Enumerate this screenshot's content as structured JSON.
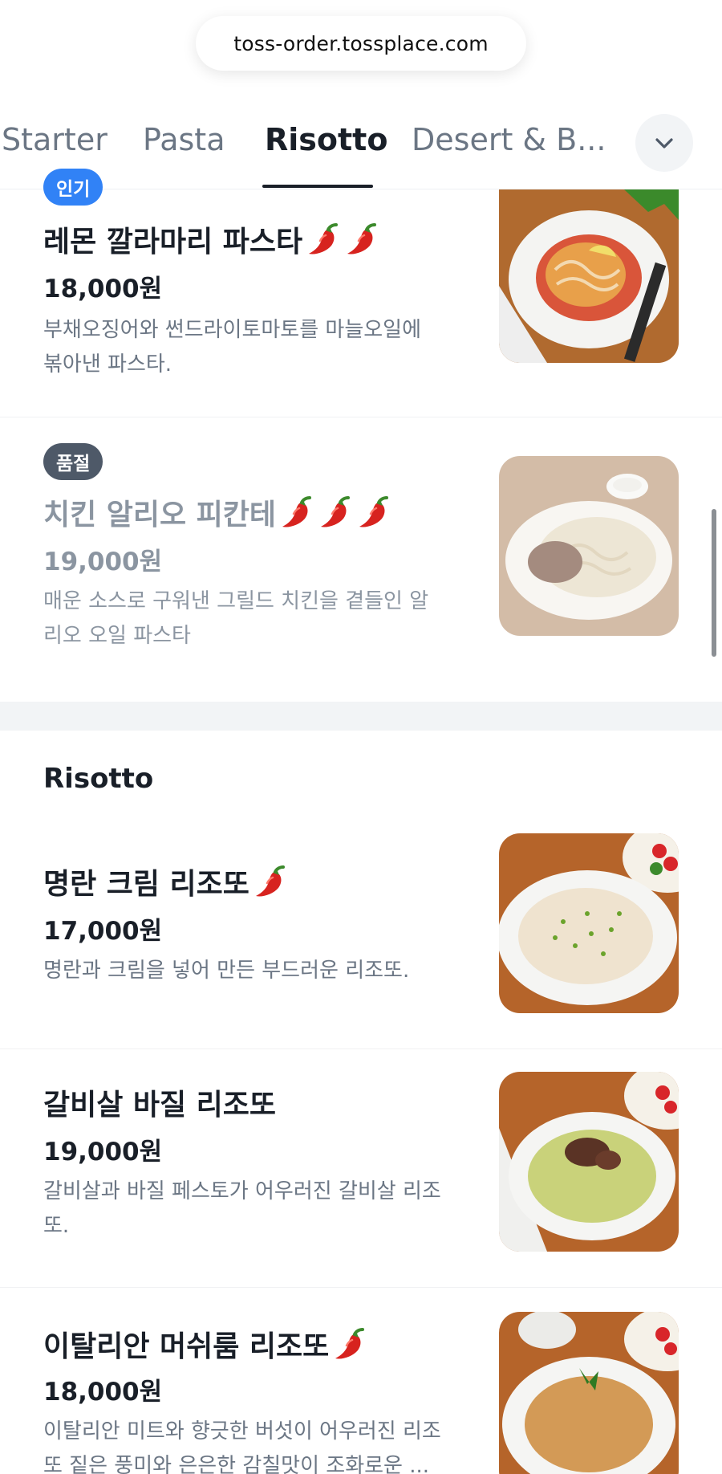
{
  "browser": {
    "url": "toss-order.tossplace.com"
  },
  "tabs": [
    {
      "label": "Starter",
      "active": false
    },
    {
      "label": "Pasta",
      "active": false
    },
    {
      "label": "Risotto",
      "active": true
    },
    {
      "label": "Desert & B...",
      "active": false
    }
  ],
  "colors": {
    "accent_blue": "#3182f6",
    "soldout_badge": "#4e5968",
    "text_primary": "#191f28",
    "text_secondary": "#6b7684"
  },
  "pasta_items": [
    {
      "badge": "인기",
      "name": "레몬 깔라마리 파스타",
      "spice": 2,
      "price": "18,000원",
      "desc": "부채오징어와 썬드라이토마토를 마늘오일에 볶아낸 파스타.",
      "image": "lemon-calamari-pasta-photo"
    },
    {
      "badge": "품절",
      "name": "치킨 알리오 피칸테",
      "spice": 3,
      "price": "19,000원",
      "desc": "매운 소스로 구워낸 그릴드 치킨을 곁들인 알리오 오일 파스타",
      "image": "chicken-aglio-piccante-photo",
      "sold_out": true
    }
  ],
  "risotto_section": {
    "title": "Risotto",
    "items": [
      {
        "name": "명란 크림 리조또",
        "spice": 1,
        "price": "17,000원",
        "desc": "명란과 크림을 넣어 만든 부드러운 리조또.",
        "image": "mentaiko-cream-risotto-photo"
      },
      {
        "name": "갈비살 바질 리조또",
        "spice": 0,
        "price": "19,000원",
        "desc": "갈비살과 바질 페스토가 어우러진 갈비살 리조또.",
        "image": "galbi-basil-risotto-photo"
      },
      {
        "name": "이탈리안 머쉬룸 리조또",
        "spice": 1,
        "price": "18,000원",
        "desc": "이탈리안 미트와 향긋한 버섯이 어우러진 리조또 짙은 풍미와 은은한 감칠맛이 조화로운 ...",
        "image": "italian-mushroom-risotto-photo"
      }
    ]
  }
}
